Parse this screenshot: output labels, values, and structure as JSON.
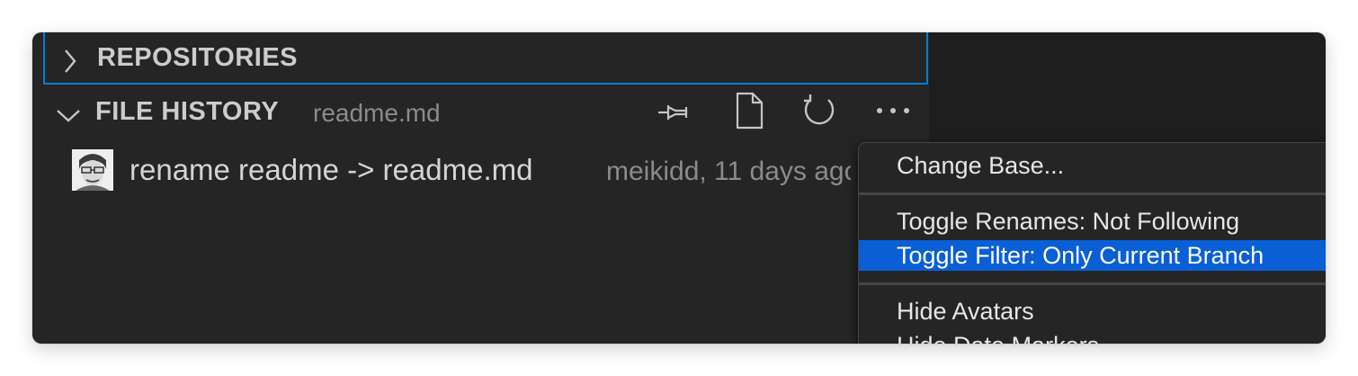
{
  "sections": {
    "repositories": {
      "title": "REPOSITORIES"
    },
    "file_history": {
      "title": "FILE HISTORY",
      "file": "readme.md",
      "actions": [
        "pin-icon",
        "file-icon",
        "refresh-icon",
        "more-icon"
      ]
    }
  },
  "history": {
    "items": [
      {
        "message": "rename readme -> readme.md",
        "meta": "meikidd, 11 days ago",
        "avatar": "avatar"
      }
    ]
  },
  "context_menu": {
    "items": [
      {
        "label": "Change Base..."
      },
      {
        "label": "Toggle Renames: Not Following"
      },
      {
        "label": "Toggle Filter: Only Current Branch",
        "selected": true
      },
      {
        "label": "Hide Avatars"
      },
      {
        "label": "Hide Date Markers"
      }
    ]
  },
  "colors": {
    "panel": "#252526",
    "focus_border": "#007fd4",
    "menu_selection": "#0a5fd4"
  }
}
